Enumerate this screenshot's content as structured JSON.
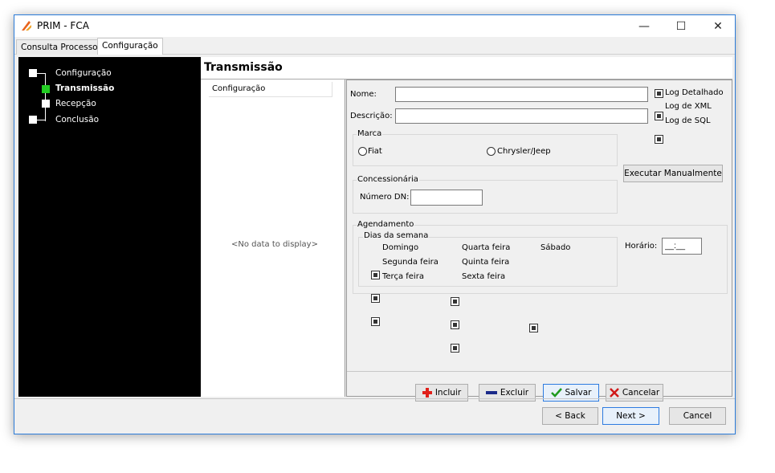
{
  "window": {
    "title": "PRIM - FCA",
    "minimize": "—",
    "maximize": "☐",
    "close": "✕"
  },
  "tabs": [
    {
      "label": "Consulta Processos"
    },
    {
      "label": "Configuração"
    }
  ],
  "wizard": {
    "steps": [
      {
        "label": "Configuração"
      },
      {
        "label": "Transmissão"
      },
      {
        "label": "Recepção"
      },
      {
        "label": "Conclusão"
      }
    ],
    "active_color": "#22cc22"
  },
  "header": {
    "title": "Transmissão"
  },
  "list": {
    "header": "Configuração",
    "empty_text": "<No data to display>"
  },
  "form": {
    "nome_label": "Nome:",
    "nome_value": "",
    "descricao_label": "Descrição:",
    "descricao_value": "",
    "log_detalhado": "Log Detalhado",
    "log_xml": "Log de XML",
    "log_sql": "Log de SQL",
    "marca": {
      "title": "Marca",
      "options": [
        "Fiat",
        "Chrysler/Jeep"
      ]
    },
    "executar": "Executar Manualmente",
    "concessionaria": {
      "title": "Concessionária",
      "numero_dn_label": "Número DN:",
      "numero_dn_value": ""
    },
    "agendamento": {
      "title": "Agendamento",
      "dias_title": "Dias da semana",
      "dias": [
        "Domingo",
        "Segunda feira",
        "Terça feira",
        "Quarta feira",
        "Quinta feira",
        "Sexta feira",
        "Sábado"
      ],
      "horario_label": "Horário:",
      "horario_value": "__:__"
    },
    "buttons": {
      "incluir": "Incluir",
      "excluir": "Excluir",
      "salvar": "Salvar",
      "cancelar": "Cancelar"
    }
  },
  "nav": {
    "back": "< Back",
    "next": "Next >",
    "cancel": "Cancel"
  },
  "colors": {
    "add": "#e0201a",
    "remove": "#1a2a8a",
    "save": "#1f9a1f",
    "cancel": "#d01818"
  }
}
